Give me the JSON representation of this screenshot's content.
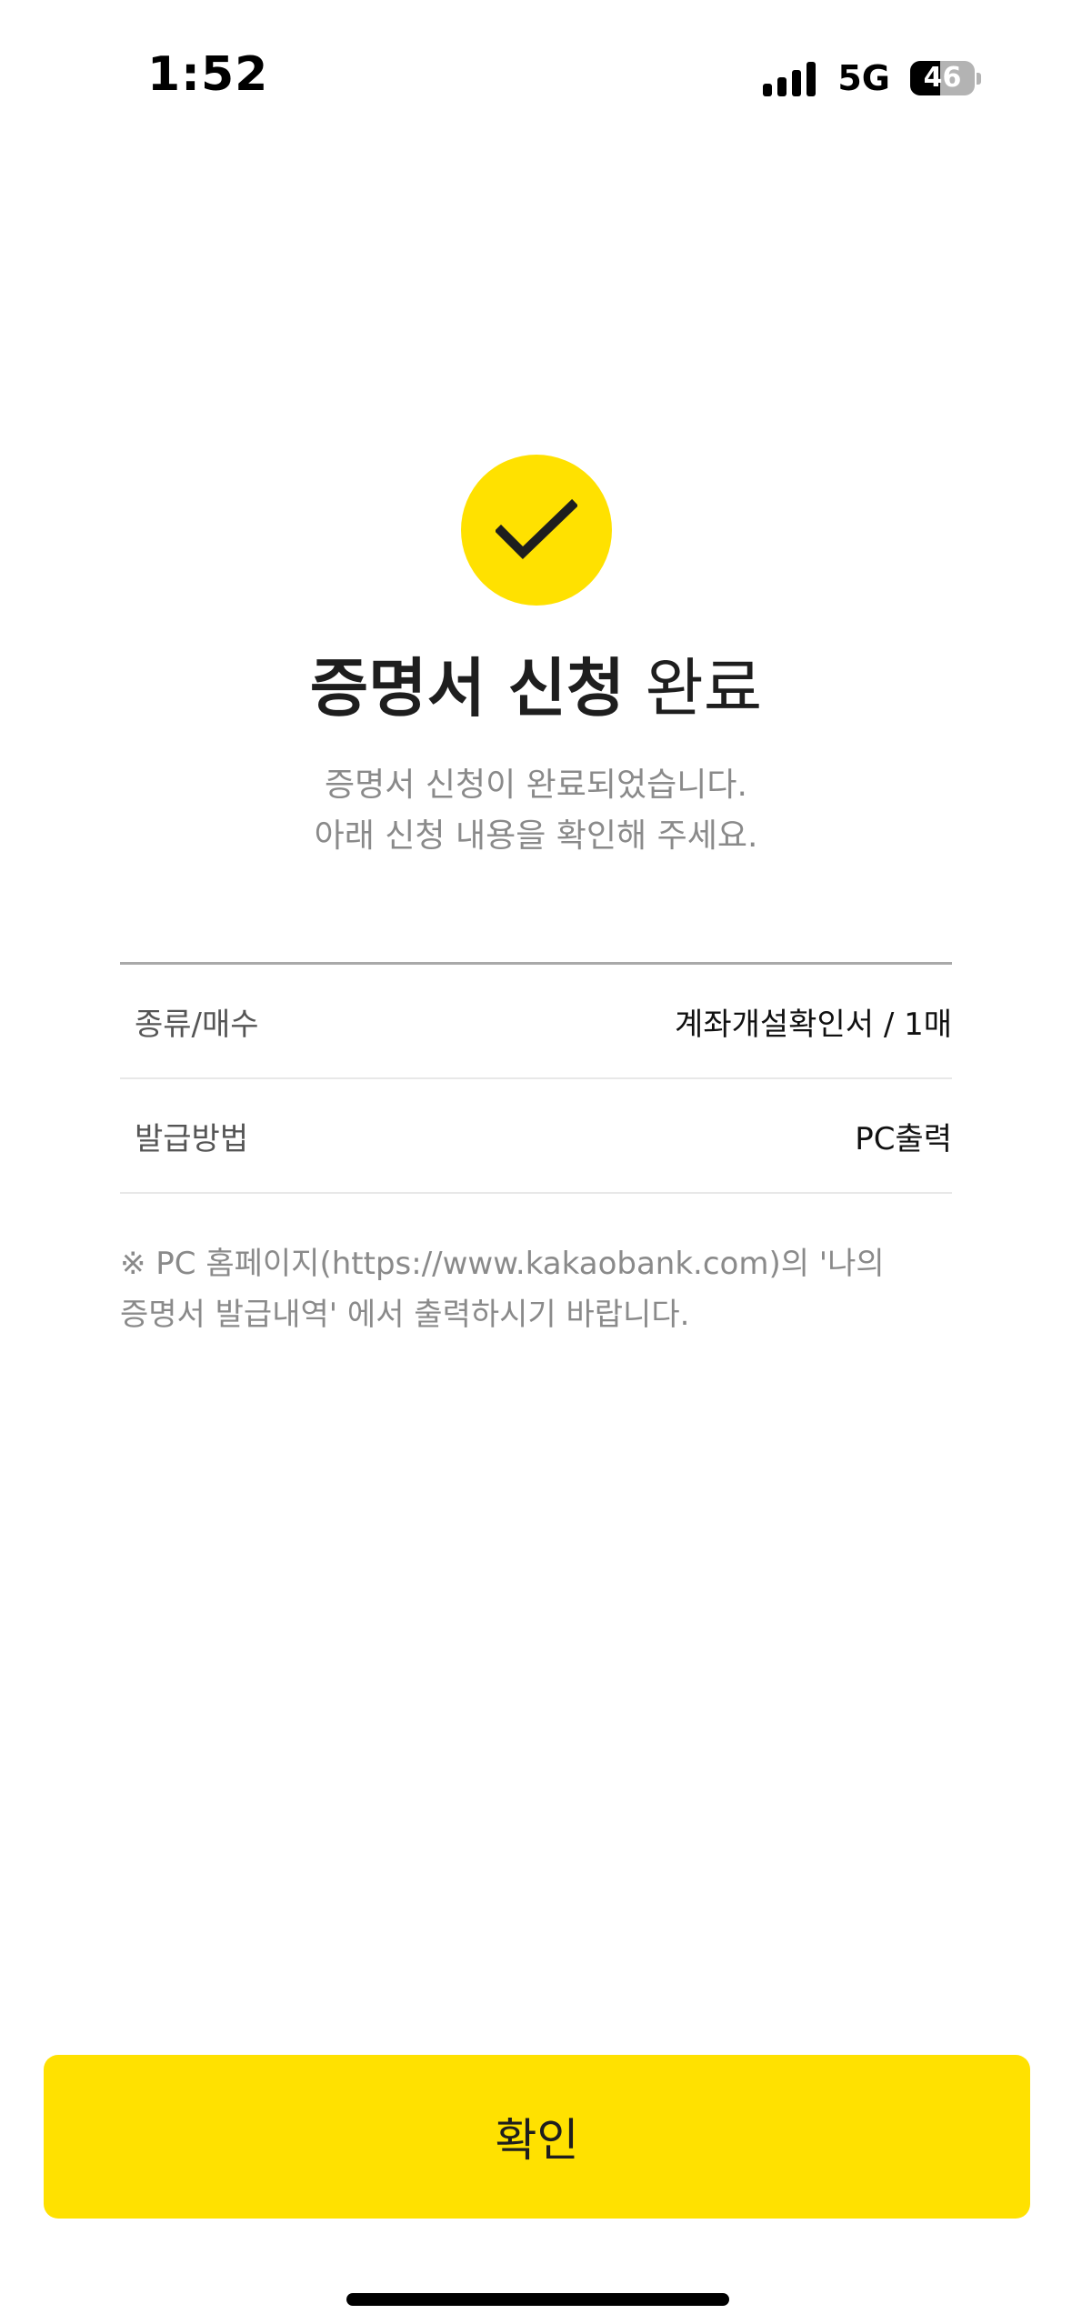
{
  "status_bar": {
    "time": "1:52",
    "network": "5G",
    "battery_level": "46",
    "battery_fraction": 0.46
  },
  "header": {
    "icon": "checkmark-icon",
    "title_bold": "증명서 신청",
    "title_light": "완료",
    "subtitle_lines": [
      "증명서 신청이 완료되었습니다.",
      "아래 신청 내용을 확인해 주세요."
    ]
  },
  "details": [
    {
      "label": "종류/매수",
      "value": "계좌개설확인서 / 1매"
    },
    {
      "label": "발급방법",
      "value": "PC출력"
    }
  ],
  "note_lines": [
    "※ PC 홈페이지(https://www.kakaobank.com)의 '나의",
    "증명서 발급내역' 에서 출력하시기 바랍니다."
  ],
  "confirm_button": {
    "label": "확인"
  },
  "colors": {
    "accent": "#ffe100",
    "text": "#1e1e1e",
    "muted": "#8a8a8a"
  }
}
